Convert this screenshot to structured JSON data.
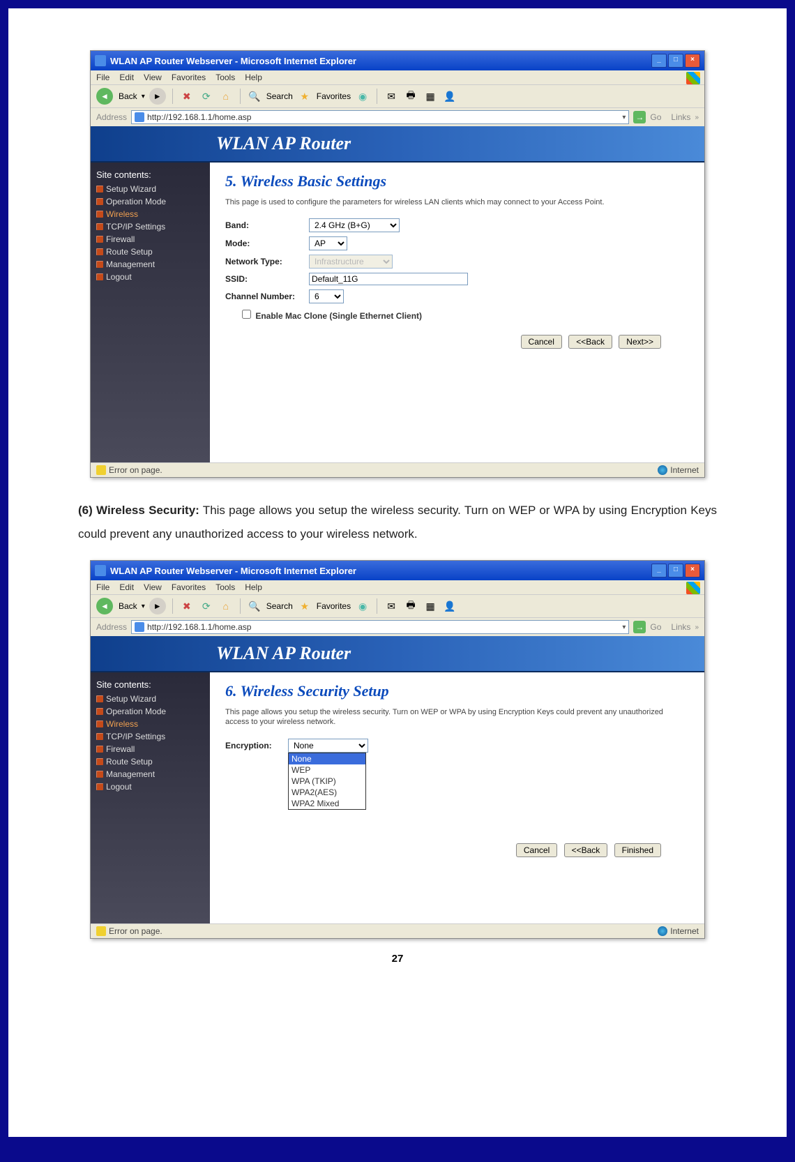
{
  "page_number": "27",
  "paragraph": {
    "bold": "(6) Wireless Security:",
    "text": " This page allows you setup the wireless security. Turn on WEP or WPA by using Encryption Keys could prevent any unauthorized access to your wireless network."
  },
  "browser": {
    "title": "WLAN AP Router Webserver - Microsoft Internet Explorer",
    "menu": {
      "file": "File",
      "edit": "Edit",
      "view": "View",
      "favorites": "Favorites",
      "tools": "Tools",
      "help": "Help"
    },
    "toolbar": {
      "back": "Back",
      "search": "Search",
      "favorites": "Favorites"
    },
    "address_label": "Address",
    "address_url": "http://192.168.1.1/home.asp",
    "go": "Go",
    "links": "Links",
    "status_text": "Error on page.",
    "status_zone": "Internet"
  },
  "router": {
    "banner": "WLAN AP Router",
    "sidebar_header": "Site contents:",
    "sidebar": {
      "i0": "Setup Wizard",
      "i1": "Operation Mode",
      "i2": "Wireless",
      "i3": "TCP/IP Settings",
      "i4": "Firewall",
      "i5": "Route Setup",
      "i6": "Management",
      "i7": "Logout"
    }
  },
  "shot1": {
    "heading": "5. Wireless Basic Settings",
    "desc": "This page is used to configure the parameters for wireless LAN clients which may connect to your Access Point.",
    "labels": {
      "band": "Band:",
      "mode": "Mode:",
      "nettype": "Network Type:",
      "ssid": "SSID:",
      "chan": "Channel Number:"
    },
    "values": {
      "band": "2.4 GHz (B+G)",
      "mode": "AP",
      "nettype": "Infrastructure",
      "ssid": "Default_11G",
      "chan": "6"
    },
    "checkbox": "Enable Mac Clone (Single Ethernet Client)",
    "buttons": {
      "cancel": "Cancel",
      "back": "<<Back",
      "next": "Next>>"
    }
  },
  "shot2": {
    "heading": "6. Wireless Security Setup",
    "desc": "This page allows you setup the wireless security. Turn on WEP or WPA by using Encryption Keys could prevent any unauthorized access to your wireless network.",
    "labels": {
      "enc": "Encryption:"
    },
    "values": {
      "enc": "None"
    },
    "options": {
      "o0": "None",
      "o1": "WEP",
      "o2": "WPA (TKIP)",
      "o3": "WPA2(AES)",
      "o4": "WPA2 Mixed"
    },
    "buttons": {
      "cancel": "Cancel",
      "back": "<<Back",
      "finished": "Finished"
    }
  }
}
